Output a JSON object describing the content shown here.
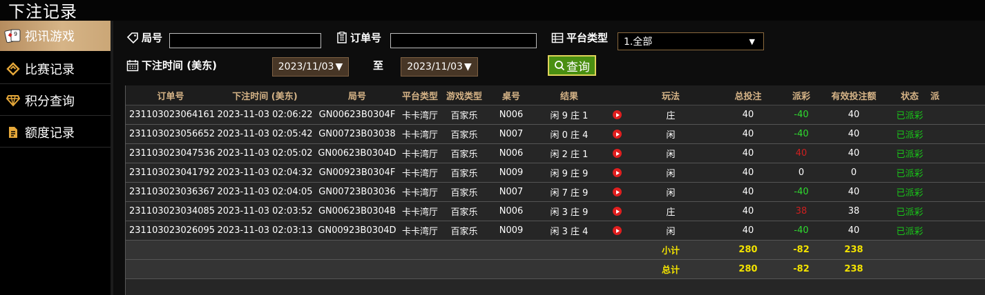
{
  "page": {
    "title": "下注记录"
  },
  "sidebar": {
    "items": [
      {
        "label": "视讯游戏",
        "icon": "playing-cards-icon",
        "active": true
      },
      {
        "label": "比赛记录",
        "icon": "diamond-outline-icon",
        "active": false
      },
      {
        "label": "积分查询",
        "icon": "gem-icon",
        "active": false
      },
      {
        "label": "额度记录",
        "icon": "document-icon",
        "active": false
      }
    ]
  },
  "filters": {
    "round_label": "局号",
    "round_value": "",
    "order_label": "订单号",
    "order_value": "",
    "platform_label": "平台类型",
    "platform_selected": "1.全部",
    "time_label": "下注时间 (美东)",
    "date_from": "2023/11/03",
    "date_to_label": "至",
    "date_to": "2023/11/03",
    "query_label": "查询"
  },
  "table": {
    "columns": [
      "订单号",
      "下注时间 (美东)",
      "局号",
      "平台类型",
      "游戏类型",
      "桌号",
      "结果",
      "",
      "玩法",
      "总投注",
      "派彩",
      "有效投注额",
      "状态",
      "派"
    ],
    "rows": [
      {
        "order": "231103023064161",
        "time": "2023-11-03 02:06:22",
        "round": "GN00623B0304F",
        "platform": "卡卡湾厅",
        "game": "百家乐",
        "table": "N006",
        "result": "闲 9 庄 1",
        "bet": "庄",
        "total": "40",
        "payout": "-40",
        "payout_tone": "win",
        "valid": "40",
        "status": "已派彩"
      },
      {
        "order": "231103023056652",
        "time": "2023-11-03 02:05:42",
        "round": "GN00723B03038",
        "platform": "卡卡湾厅",
        "game": "百家乐",
        "table": "N007",
        "result": "闲 0 庄 4",
        "bet": "闲",
        "total": "40",
        "payout": "-40",
        "payout_tone": "win",
        "valid": "40",
        "status": "已派彩"
      },
      {
        "order": "231103023047536",
        "time": "2023-11-03 02:05:02",
        "round": "GN00623B0304D",
        "platform": "卡卡湾厅",
        "game": "百家乐",
        "table": "N006",
        "result": "闲 2 庄 1",
        "bet": "闲",
        "total": "40",
        "payout": "40",
        "payout_tone": "loss",
        "valid": "40",
        "status": "已派彩"
      },
      {
        "order": "231103023041792",
        "time": "2023-11-03 02:04:32",
        "round": "GN00923B0304F",
        "platform": "卡卡湾厅",
        "game": "百家乐",
        "table": "N009",
        "result": "闲 9 庄 9",
        "bet": "闲",
        "total": "40",
        "payout": "0",
        "payout_tone": "neutral",
        "valid": "0",
        "status": "已派彩"
      },
      {
        "order": "231103023036367",
        "time": "2023-11-03 02:04:05",
        "round": "GN00723B03036",
        "platform": "卡卡湾厅",
        "game": "百家乐",
        "table": "N007",
        "result": "闲 7 庄 9",
        "bet": "闲",
        "total": "40",
        "payout": "-40",
        "payout_tone": "win",
        "valid": "40",
        "status": "已派彩"
      },
      {
        "order": "231103023034085",
        "time": "2023-11-03 02:03:52",
        "round": "GN00623B0304B",
        "platform": "卡卡湾厅",
        "game": "百家乐",
        "table": "N006",
        "result": "闲 3 庄 9",
        "bet": "庄",
        "total": "40",
        "payout": "38",
        "payout_tone": "loss",
        "valid": "38",
        "status": "已派彩"
      },
      {
        "order": "231103023026095",
        "time": "2023-11-03 02:03:13",
        "round": "GN00923B0304D",
        "platform": "卡卡湾厅",
        "game": "百家乐",
        "table": "N009",
        "result": "闲 3 庄 4",
        "bet": "闲",
        "total": "40",
        "payout": "-40",
        "payout_tone": "win",
        "valid": "40",
        "status": "已派彩"
      }
    ],
    "subtotal": {
      "label": "小计",
      "total": "280",
      "payout": "-82",
      "valid": "238"
    },
    "grand_total": {
      "label": "总计",
      "total": "280",
      "payout": "-82",
      "valid": "238"
    }
  },
  "colors": {
    "accent_gold": "#d6b487",
    "summary_yellow": "#f2e200",
    "status_green": "#19c719",
    "loss_red": "#cf1f1f",
    "win_green": "#2fdc2f",
    "query_green": "#4a8f12"
  }
}
